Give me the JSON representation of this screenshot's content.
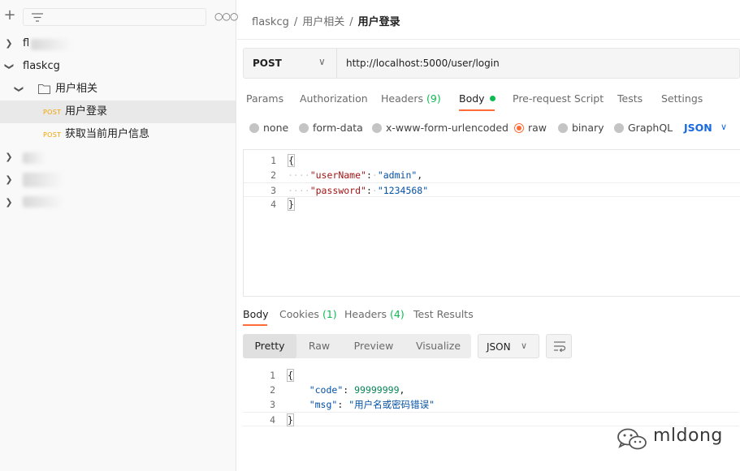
{
  "sidebar": {
    "tree": [
      {
        "label": "fl",
        "blurred": true
      },
      {
        "label": "flaskcg",
        "expanded": true
      },
      {
        "label": "用户相关",
        "type": "folder"
      },
      {
        "label": "用户登录",
        "method": "POST",
        "selected": true
      },
      {
        "label": "获取当前用户信息",
        "method": "POST"
      },
      {
        "label": "",
        "blurred": true
      },
      {
        "label": "",
        "blurred": true
      },
      {
        "label": "",
        "blurred": true
      }
    ]
  },
  "breadcrumb": [
    "flaskcg",
    "用户相关",
    "用户登录"
  ],
  "request": {
    "method": "POST",
    "url": "http://localhost:5000/user/login"
  },
  "request_tabs": [
    {
      "label": "Params"
    },
    {
      "label": "Authorization"
    },
    {
      "label": "Headers",
      "count": "(9)"
    },
    {
      "label": "Body",
      "active": true
    },
    {
      "label": "Pre-request Script"
    },
    {
      "label": "Tests"
    },
    {
      "label": "Settings"
    }
  ],
  "body_types": [
    "none",
    "form-data",
    "x-www-form-urlencoded",
    "raw",
    "binary",
    "GraphQL"
  ],
  "body_type_selected": "raw",
  "body_format": "JSON",
  "request_body": {
    "line_numbers": [
      "1",
      "2",
      "3",
      "4"
    ],
    "open": "{",
    "k1": "\"userName\"",
    "v1": "\"admin\"",
    "k2": "\"password\"",
    "v2": "\"1234568\"",
    "close": "}"
  },
  "response_tabs": [
    {
      "label": "Body",
      "active": true
    },
    {
      "label": "Cookies",
      "count": "(1)"
    },
    {
      "label": "Headers",
      "count": "(4)"
    },
    {
      "label": "Test Results"
    }
  ],
  "view_tabs": [
    "Pretty",
    "Raw",
    "Preview",
    "Visualize"
  ],
  "response_format": "JSON",
  "response_body": {
    "line_numbers": [
      "1",
      "2",
      "3",
      "4"
    ],
    "open": "{",
    "k1": "\"code\"",
    "v1": "99999999",
    "k2": "\"msg\"",
    "v2": "\"用户名或密码错误\"",
    "close": "}"
  },
  "watermark": "mldong",
  "colors": {
    "accent": "#ff6c37",
    "count_green": "#0cbb52",
    "json_blue": "#1769e0",
    "post_orange": "#f2a300"
  }
}
